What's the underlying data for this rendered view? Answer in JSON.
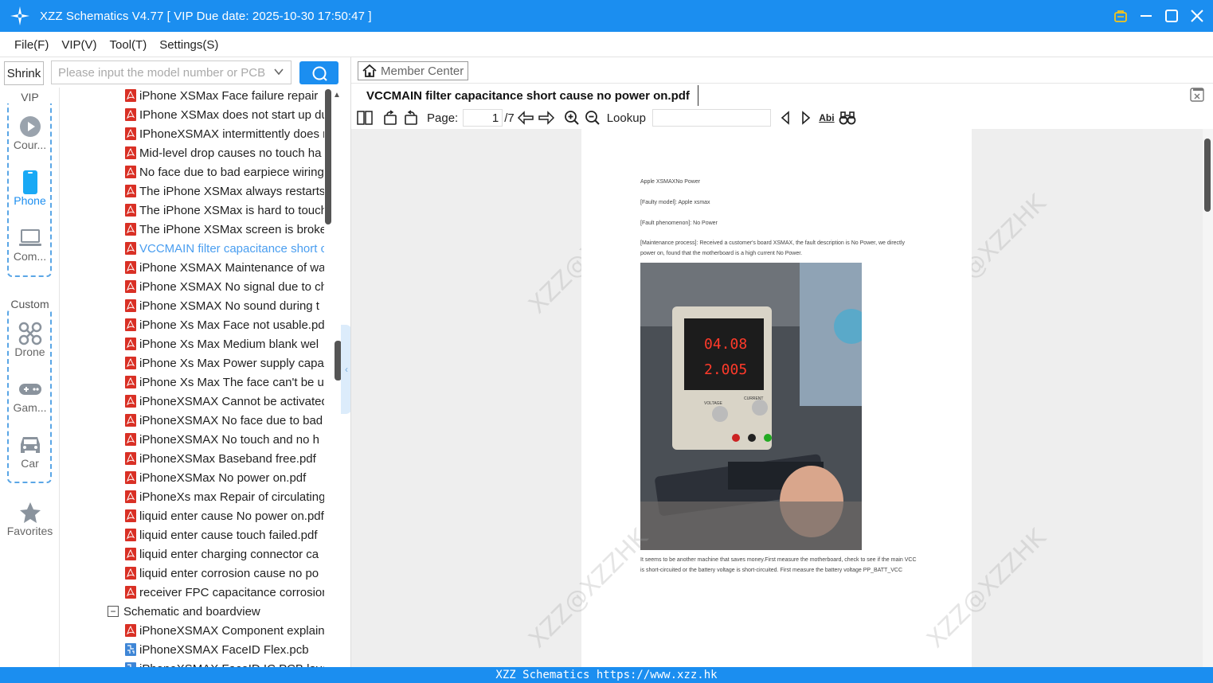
{
  "window": {
    "title": "XZZ Schematics V4.77 [ VIP Due date: 2025-10-30 17:50:47 ]"
  },
  "menu": [
    "File(F)",
    "VIP(V)",
    "Tool(T)",
    "Settings(S)"
  ],
  "left_rail": {
    "shrink_label": "Shrink",
    "vip_label": "VIP",
    "custom_label": "Custom",
    "vip_items": [
      {
        "label": "Cour...",
        "icon": "play-circle-icon"
      },
      {
        "label": "Phone",
        "icon": "phone-icon"
      },
      {
        "label": "Com...",
        "icon": "laptop-icon"
      }
    ],
    "custom_items": [
      {
        "label": "Drone",
        "icon": "drone-icon"
      },
      {
        "label": "Gam...",
        "icon": "gamepad-icon"
      },
      {
        "label": "Car",
        "icon": "car-icon"
      }
    ],
    "favorites_label": "Favorites"
  },
  "search": {
    "placeholder": "Please input the model number or PCB"
  },
  "tree": {
    "items": [
      {
        "label": "iPhone XSMax Face failure repair",
        "type": "pdf"
      },
      {
        "label": "IPhone XSMax does not start up due",
        "type": "pdf"
      },
      {
        "label": "IPhoneXSMAX intermittently does not",
        "type": "pdf"
      },
      {
        "label": "Mid-level drop causes no touch ha",
        "type": "pdf"
      },
      {
        "label": "No face due to bad earpiece wiring",
        "type": "pdf"
      },
      {
        "label": "The iPhone XSMax always restarts.",
        "type": "pdf"
      },
      {
        "label": "The iPhone XSMax is hard to touch",
        "type": "pdf"
      },
      {
        "label": "The iPhone XSMax screen is broken",
        "type": "pdf"
      },
      {
        "label": "VCCMAIN filter capacitance short c",
        "type": "pdf",
        "active": true
      },
      {
        "label": "iPhone XSMAX Maintenance of wa",
        "type": "pdf"
      },
      {
        "label": "iPhone XSMAX No signal due to ch",
        "type": "pdf"
      },
      {
        "label": "iPhone XSMAX No sound during t",
        "type": "pdf"
      },
      {
        "label": "iPhone Xs Max Face not usable.pdf",
        "type": "pdf"
      },
      {
        "label": "iPhone Xs Max Medium blank wel",
        "type": "pdf"
      },
      {
        "label": "iPhone Xs Max Power supply capa",
        "type": "pdf"
      },
      {
        "label": "iPhone Xs Max The face can't be u",
        "type": "pdf"
      },
      {
        "label": "iPhoneXSMAX Cannot be activated",
        "type": "pdf"
      },
      {
        "label": "iPhoneXSMAX No face due to bad",
        "type": "pdf"
      },
      {
        "label": "iPhoneXSMAX No touch and no h",
        "type": "pdf"
      },
      {
        "label": "iPhoneXSMax Baseband free.pdf",
        "type": "pdf"
      },
      {
        "label": "iPhoneXSMax No power on.pdf",
        "type": "pdf"
      },
      {
        "label": "iPhoneXs max Repair of circulating",
        "type": "pdf"
      },
      {
        "label": "liquid enter cause No power on.pdf",
        "type": "pdf"
      },
      {
        "label": "liquid enter cause touch failed.pdf",
        "type": "pdf"
      },
      {
        "label": "liquid enter charging connector ca",
        "type": "pdf"
      },
      {
        "label": "liquid enter corrosion cause no po",
        "type": "pdf"
      },
      {
        "label": "receiver FPC capacitance corrosion",
        "type": "pdf"
      }
    ],
    "folder": {
      "label": "Schematic and boardview",
      "toggle": "−"
    },
    "folder_items": [
      {
        "label": "iPhoneXSMAX Component explain",
        "type": "pdf"
      },
      {
        "label": "iPhoneXSMAX FaceID Flex.pcb",
        "type": "pcb"
      },
      {
        "label": "iPhoneXSMAX FaceID IC PCB layer",
        "type": "pcb"
      }
    ]
  },
  "doc": {
    "member_center": "Member Center",
    "tab_title": "VCCMAIN filter capacitance short cause no power on.pdf",
    "page_label": "Page:",
    "page_current": "1",
    "page_total": "/7",
    "lookup_label": "Lookup",
    "lookup_value": ""
  },
  "page_content": {
    "line1": "Apple XSMAXNo Power",
    "line2": "[Faulty model]: Apple xsmax",
    "line3": "[Fault phenomenon]: No Power",
    "line4": "[Maintenance process]: Received a customer's board XSMAX, the fault description is No Power, we directly power on, found that the motherboard is a high current No Power.",
    "line5": "It seems to be another machine that saves money.First measure the motherboard, check to see if the main VCC is short-circuited or the battery voltage is short-circuited. First measure the battery voltage PP_BATT_VCC",
    "psu_voltage": "04.08",
    "psu_current": "2.005",
    "psu_voltage_label": "VOLTAGE",
    "psu_current_label": "CURRENT",
    "watermark": "XZZ@XZZHK"
  },
  "status": {
    "text": "XZZ Schematics https://www.xzz.hk"
  },
  "colors": {
    "accent": "#1b8ef0",
    "active_link": "#4a9ef0",
    "pdf_icon": "#d93025"
  }
}
